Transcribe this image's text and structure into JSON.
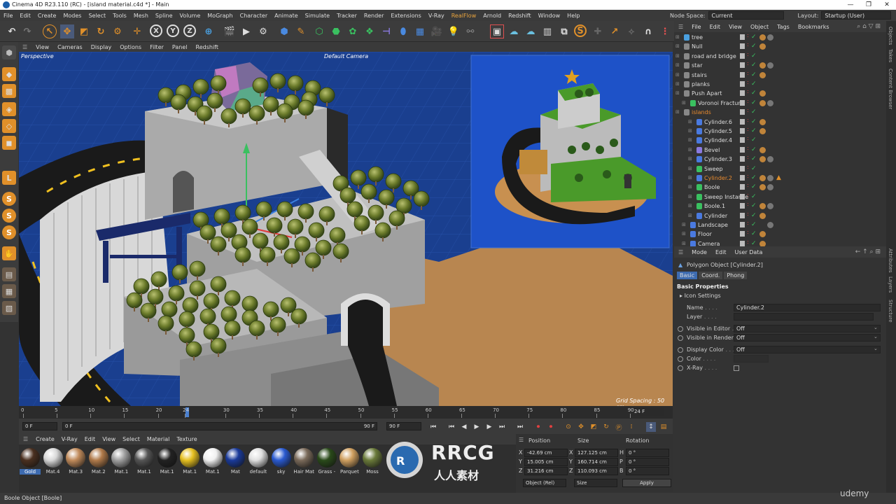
{
  "window": {
    "title": "Cinema 4D R23.110 (RC) - [island material.c4d *] - Main"
  },
  "menu": [
    "File",
    "Edit",
    "Create",
    "Modes",
    "Select",
    "Tools",
    "Mesh",
    "Spline",
    "Volume",
    "MoGraph",
    "Character",
    "Animate",
    "Simulate",
    "Tracker",
    "Render",
    "Extensions",
    "V-Ray",
    "RealFlow",
    "Arnold",
    "Redshift",
    "Window",
    "Help"
  ],
  "nodespace": {
    "label": "Node Space:",
    "value": "Current (Standard/Physical)",
    "layout_label": "Layout:",
    "layout_value": "Startup (User)"
  },
  "viewport": {
    "menu": [
      "View",
      "Cameras",
      "Display",
      "Options",
      "Filter",
      "Panel",
      "Redshift"
    ],
    "view_name": "Perspective",
    "camera_name": "Default Camera",
    "grid_spacing": "Grid Spacing : 50 cm"
  },
  "timeline": {
    "ticks": [
      "0",
      "5",
      "10",
      "15",
      "20",
      "24",
      "30",
      "35",
      "40",
      "45",
      "50",
      "55",
      "60",
      "65",
      "70",
      "75",
      "80",
      "85",
      "90"
    ],
    "current_frame": "24 F"
  },
  "transport": {
    "start": "0 F",
    "current": "0 F",
    "end": "90 F",
    "end2": "90 F"
  },
  "materials": {
    "menu": [
      "Create",
      "V-Ray",
      "Edit",
      "View",
      "Select",
      "Material",
      "Texture"
    ],
    "items": [
      {
        "label": "Gold",
        "color": "#4a3020",
        "selected": true
      },
      {
        "label": "Mat.4",
        "color": "#d8d8d8"
      },
      {
        "label": "Mat.3",
        "color": "#c08a5a"
      },
      {
        "label": "Mat.2",
        "color": "#b07a4a"
      },
      {
        "label": "Mat.1",
        "color": "#a0a0a0"
      },
      {
        "label": "Mat.1",
        "color": "#555555"
      },
      {
        "label": "Mat.1",
        "color": "#222222"
      },
      {
        "label": "Mat.1",
        "color": "#e6c020"
      },
      {
        "label": "Mat.1",
        "color": "#f0f0f0"
      },
      {
        "label": "Mat",
        "color": "#1a3a9a"
      },
      {
        "label": "default",
        "color": "#e0e0e0"
      },
      {
        "label": "sky",
        "color": "#2a5ad0"
      },
      {
        "label": "Hair Mat",
        "color": "#7a6a5a"
      },
      {
        "label": "Grass -",
        "color": "#2a4a1a"
      },
      {
        "label": "Parquet",
        "color": "#d0a060"
      },
      {
        "label": "Moss",
        "color": "#6a7a3a"
      }
    ]
  },
  "coords": {
    "headers": [
      "Position",
      "Size",
      "Rotation"
    ],
    "rows": [
      {
        "axis": "X",
        "pos": "-42.69 cm",
        "size_axis": "X",
        "size": "127.125 cm",
        "rot_axis": "H",
        "rot": "0 °"
      },
      {
        "axis": "Y",
        "pos": "15.005 cm",
        "size_axis": "Y",
        "size": "160.714 cm",
        "rot_axis": "P",
        "rot": "0 °"
      },
      {
        "axis": "Z",
        "pos": "31.216 cm",
        "size_axis": "Z",
        "size": "110.093 cm",
        "rot_axis": "B",
        "rot": "0 °"
      }
    ],
    "mode": "Object (Rel)",
    "size_mode": "Size",
    "apply": "Apply"
  },
  "objects": {
    "menu": [
      "File",
      "Edit",
      "View",
      "Object",
      "Tags",
      "Bookmarks"
    ],
    "rows": [
      {
        "name": "tree",
        "color": "#4aa0e0",
        "indent": 0
      },
      {
        "name": "Null",
        "color": "#888888",
        "indent": 0
      },
      {
        "name": "road and bridge",
        "color": "#888888",
        "indent": 0
      },
      {
        "name": "star",
        "color": "#888888",
        "indent": 0
      },
      {
        "name": "stairs",
        "color": "#888888",
        "indent": 0
      },
      {
        "name": "planks",
        "color": "#888888",
        "indent": 0
      },
      {
        "name": "Push Apart",
        "color": "#888888",
        "indent": 0
      },
      {
        "name": "Voronoi Fracture",
        "color": "#3ac060",
        "indent": 1
      },
      {
        "name": "islands",
        "color": "#888888",
        "indent": 0,
        "orange": true
      },
      {
        "name": "Cylinder.6",
        "color": "#4a7ae0",
        "indent": 2
      },
      {
        "name": "Cylinder.5",
        "color": "#4a7ae0",
        "indent": 2
      },
      {
        "name": "Cylinder.4",
        "color": "#4a7ae0",
        "indent": 2
      },
      {
        "name": "Bevel",
        "color": "#8a7ae0",
        "indent": 2
      },
      {
        "name": "Cylinder.3",
        "color": "#4a7ae0",
        "indent": 2
      },
      {
        "name": "Sweep",
        "color": "#3ac060",
        "indent": 2
      },
      {
        "name": "Cylinder.2",
        "color": "#4a7ae0",
        "indent": 2,
        "orange": true
      },
      {
        "name": "Boole",
        "color": "#3ac060",
        "indent": 2
      },
      {
        "name": "Sweep Instance",
        "color": "#3ac060",
        "indent": 2
      },
      {
        "name": "Boole.1",
        "color": "#3ac060",
        "indent": 2
      },
      {
        "name": "Cylinder",
        "color": "#4a7ae0",
        "indent": 2
      },
      {
        "name": "Landscape",
        "color": "#4a7ae0",
        "indent": 1
      },
      {
        "name": "Floor",
        "color": "#4a7ae0",
        "indent": 1
      },
      {
        "name": "Camera",
        "color": "#4a7ae0",
        "indent": 1
      }
    ]
  },
  "attributes": {
    "menu": [
      "Mode",
      "Edit",
      "User Data"
    ],
    "object_title": "Polygon Object [Cylinder.2]",
    "tabs": [
      "Basic",
      "Coord.",
      "Phong"
    ],
    "section": "Basic Properties",
    "icon_settings": "Icon Settings",
    "fields": [
      {
        "label": "Name",
        "value": "Cylinder.2"
      },
      {
        "label": "Layer",
        "value": ""
      },
      {
        "label": "Visible in Editor",
        "value": "Off"
      },
      {
        "label": "Visible in Renderer",
        "value": "Off"
      },
      {
        "label": "Display Color",
        "value": "Off"
      },
      {
        "label": "Color",
        "value": ""
      },
      {
        "label": "X-Ray",
        "value": ""
      }
    ]
  },
  "side_tabs": [
    "Objects",
    "Takes",
    "Content Browser",
    "Attributes",
    "Layers",
    "Structure"
  ],
  "status": "Boole Object [Boole]",
  "watermark": {
    "brand": "RRCG",
    "sub": "人人素材",
    "udemy": "udemy"
  }
}
